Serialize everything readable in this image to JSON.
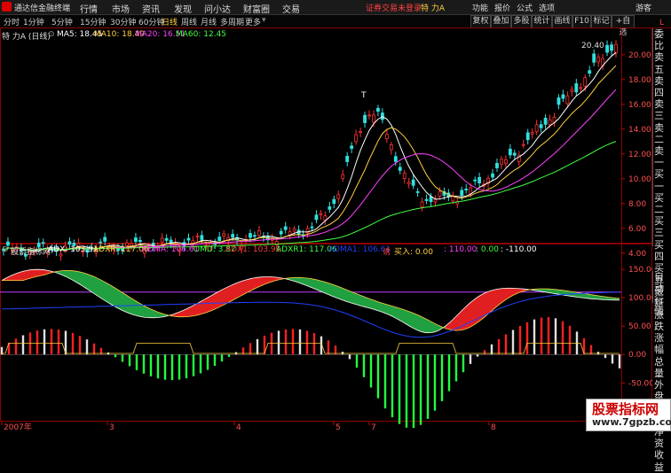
{
  "titlebar": {
    "app_title": "通达信金融终端",
    "menus": [
      "行情",
      "市场",
      "资讯",
      "发现",
      "问小达",
      "财富圈",
      "交易"
    ],
    "warning": "证券交易未登录",
    "ticker": "特 力A",
    "right_items": [
      "功能",
      "报价",
      "公式",
      "选项"
    ],
    "guest": "游客"
  },
  "periods": {
    "items": [
      "分时",
      "1分钟",
      "5分钟",
      "15分钟",
      "30分钟",
      "60分钟",
      "日线",
      "周线",
      "月线",
      "多周期",
      "更多"
    ],
    "active": "日线"
  },
  "right_buttons": [
    "复权",
    "叠加",
    "多股",
    "统计",
    "画线",
    "F10",
    "标记",
    "+自选"
  ],
  "main_chart": {
    "stock": "特 力A (日线)",
    "ma": [
      {
        "label": "MA5: 18.45",
        "color": "#ffffff"
      },
      {
        "label": "MA10: 18.49",
        "color": "#ffd040"
      },
      {
        "label": "MA20: 16.51",
        "color": "#ff40ff"
      },
      {
        "label": "MA60: 12.45",
        "color": "#40ff40"
      }
    ],
    "high_label": "20.40",
    "peak_label": "T",
    "y_ticks": [
      "20.00",
      "18.00",
      "16.00",
      "14.00",
      "12.00",
      "10.00",
      "8.00",
      "6.00",
      "4.00"
    ]
  },
  "sidebar": [
    "委比",
    "卖五",
    "卖四",
    "卖三",
    "卖二",
    "卖一",
    "买一",
    "买二",
    "买三",
    "买四",
    "买五",
    "最新",
    "涨跌",
    "涨幅",
    "总量",
    "外盘",
    "换手",
    "净资",
    "收益"
  ],
  "sidebar2": [
    "自动",
    "行情"
  ],
  "indicator": {
    "name": "股票指标网",
    "labels": [
      {
        "text": "ADX: 103.91",
        "color": "#ffffff"
      },
      {
        "text": "ADXR: 117.06",
        "color": "#ffd040"
      },
      {
        "text": "ADMA: 106.61",
        "color": "#ff40ff"
      },
      {
        "text": "OMD: 3.87",
        "color": "#40ff40"
      },
      {
        "text": "ADX1: 103.91",
        "color": "#ff4040"
      },
      {
        "text": "ADXR1: 117.06",
        "color": "#40ff40"
      },
      {
        "text": "ADMA1: 106.61",
        "color": "#2040ff"
      },
      {
        "text": "诱",
        "color": "#ff4040"
      },
      {
        "text": "买入: 0.00",
        "color": "#ffd040"
      },
      {
        "text": ": 110.00",
        "color": "#ff40ff"
      },
      {
        "text": ": 0.00",
        "color": "#40ff40"
      },
      {
        "text": ": -110.00",
        "color": "#ffffff"
      }
    ],
    "y_ticks": [
      "150.00",
      "100.00",
      "50.00",
      "0.00",
      "-50.00",
      "-100.00"
    ]
  },
  "x_axis": [
    "2007年",
    "3",
    "4",
    "5",
    "7",
    "8"
  ],
  "watermark": {
    "line1": "股票指标网",
    "line2": "www.7gpzb.com"
  },
  "colors": {
    "up": "#ff3030",
    "down": "#30e0e0",
    "bg": "#000000",
    "grid": "#8b0000"
  }
}
